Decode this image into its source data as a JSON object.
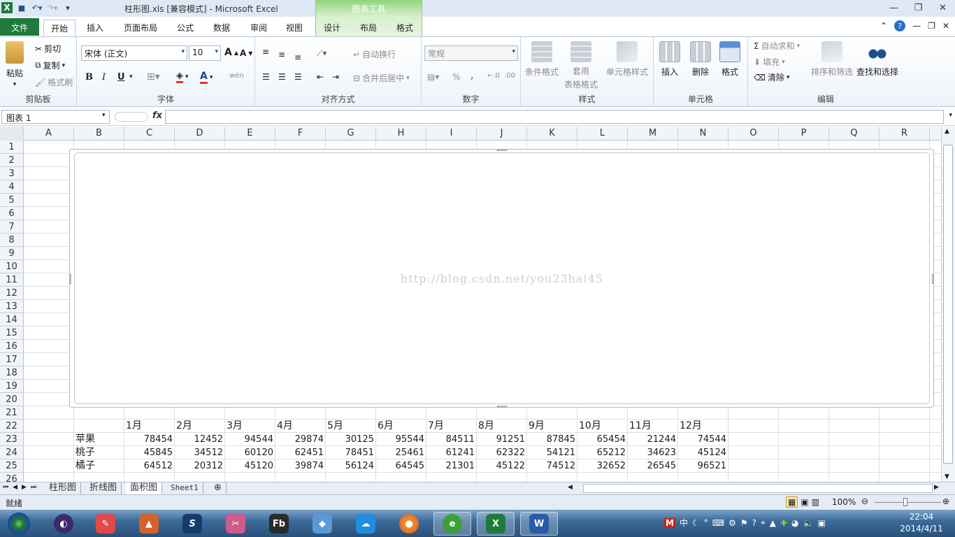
{
  "window": {
    "title": "柱形图.xls  [兼容模式] - Microsoft Excel",
    "chart_tools": "图表工具"
  },
  "tabs": [
    "文件",
    "开始",
    "插入",
    "页面布局",
    "公式",
    "数据",
    "审阅",
    "视图",
    "设计",
    "布局",
    "格式"
  ],
  "ribbon": {
    "clipboard": {
      "paste": "粘贴",
      "cut": "剪切",
      "copy": "复制",
      "format_painter": "格式刷",
      "label": "剪贴板"
    },
    "font": {
      "name": "宋体 (正文)",
      "size": "10",
      "bold": "B",
      "italic": "I",
      "underline": "U",
      "label": "字体",
      "grow": "A",
      "shrink": "A",
      "color_glyph": "A",
      "wen": "wén"
    },
    "alignment": {
      "wrap": "自动换行",
      "merge": "合并后居中",
      "label": "对齐方式"
    },
    "number": {
      "format": "常规",
      "percent": "%",
      "comma": ",",
      "label": "数字"
    },
    "styles": {
      "conditional": "条件格式",
      "table_line1": "套用",
      "table_line2": "表格格式",
      "cell_styles": "单元格样式",
      "label": "样式"
    },
    "cells": {
      "insert": "插入",
      "delete": "删除",
      "format": "格式",
      "label": "单元格"
    },
    "editing": {
      "autosum": "自动求和",
      "fill": "填充",
      "clear": "清除",
      "sort": "排序和筛选",
      "find": "查找和选择",
      "label": "编辑"
    }
  },
  "formula_bar": {
    "name_box": "图表 1",
    "fx": "fx",
    "value": ""
  },
  "columns": [
    "A",
    "B",
    "C",
    "D",
    "E",
    "F",
    "G",
    "H",
    "I",
    "J",
    "K",
    "L",
    "M",
    "N",
    "O",
    "P",
    "Q",
    "R"
  ],
  "rows": [
    "1",
    "2",
    "3",
    "4",
    "5",
    "6",
    "7",
    "8",
    "9",
    "10",
    "11",
    "12",
    "13",
    "14",
    "15",
    "16",
    "17",
    "18",
    "19",
    "20",
    "21",
    "22",
    "23",
    "24",
    "25",
    "26"
  ],
  "table": {
    "months": [
      "1月",
      "2月",
      "3月",
      "4月",
      "5月",
      "6月",
      "7月",
      "8月",
      "9月",
      "10月",
      "11月",
      "12月"
    ],
    "data": [
      {
        "name": "苹果",
        "values": [
          "78454",
          "12452",
          "94544",
          "29874",
          "30125",
          "95544",
          "84511",
          "91251",
          "87845",
          "65454",
          "21244",
          "74544"
        ]
      },
      {
        "name": "桃子",
        "values": [
          "45845",
          "34512",
          "60120",
          "62451",
          "78451",
          "25461",
          "61241",
          "62322",
          "54121",
          "65212",
          "34623",
          "45124"
        ]
      },
      {
        "name": "橘子",
        "values": [
          "64512",
          "20312",
          "45120",
          "39874",
          "56124",
          "64545",
          "21301",
          "45122",
          "74512",
          "32652",
          "26545",
          "96521"
        ]
      }
    ]
  },
  "chart": {
    "watermark": "http://blog.csdn.net/you23hai45"
  },
  "sheets": [
    "柱形图",
    "折线图",
    "面积图",
    "Sheet1"
  ],
  "active_sheet": "面积图",
  "status": {
    "ready": "就绪",
    "zoom": "100%"
  },
  "clock": {
    "time": "22:04",
    "date": "2014/4/11"
  },
  "tray": {
    "ime": "中"
  },
  "colors": {
    "excel_green": "#1f7a3b",
    "chart_tools_green": "#8fd47c",
    "taskbar": "#29507a"
  }
}
